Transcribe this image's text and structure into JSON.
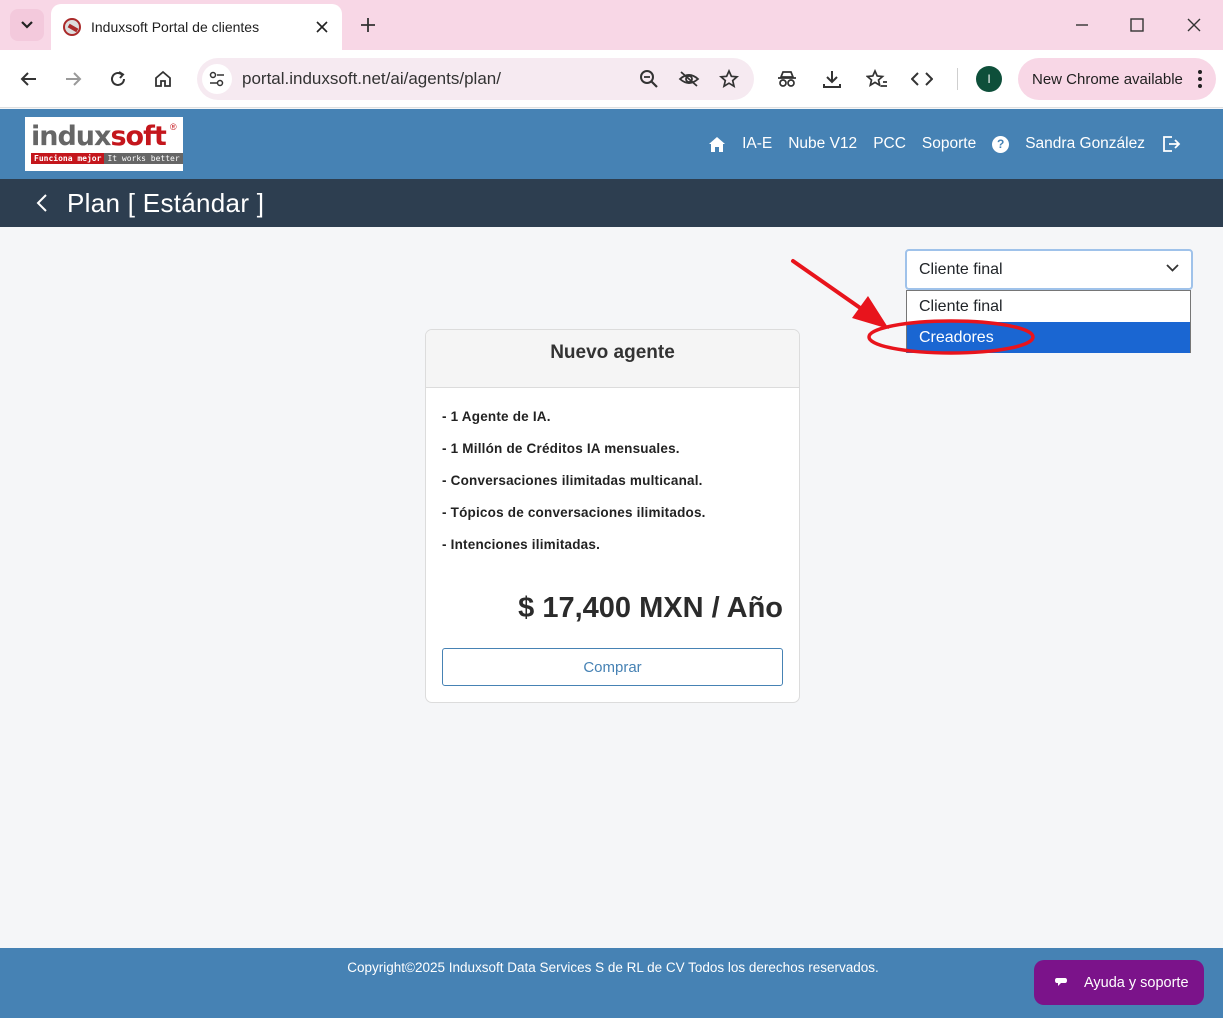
{
  "browser": {
    "tab_title": "Induxsoft Portal de clientes",
    "url": "portal.induxsoft.net/ai/agents/plan/",
    "profile_initial": "I",
    "update_label": "New Chrome available"
  },
  "site": {
    "logo": {
      "word_part1": "indux",
      "word_part2": "soft",
      "reg_mark": "®",
      "tag_red": "Funciona mejor",
      "tag_gray": "It works better"
    },
    "nav": {
      "items": [
        "IA-E",
        "Nube V12",
        "PCC",
        "Soporte"
      ],
      "help": "?",
      "user": "Sandra González"
    }
  },
  "page": {
    "title": "Plan [ Estándar ]",
    "select": {
      "value": "Cliente final",
      "options": [
        "Cliente final",
        "Creadores"
      ],
      "highlighted": "Creadores"
    },
    "card": {
      "heading": "Nuevo agente",
      "features": [
        "- 1 Agente de IA.",
        "- 1 Millón de Créditos IA mensuales.",
        "- Conversaciones ilimitadas multicanal.",
        "- Tópicos de conversaciones ilimitados.",
        "- Intenciones ilimitadas."
      ],
      "price": "$ 17,400 MXN / Año",
      "buy_label": "Comprar"
    }
  },
  "footer": {
    "copyright": "Copyright©2025 Induxsoft Data Services S de RL de CV Todos los derechos reservados.",
    "help_label": "Ayuda y soporte"
  },
  "colors": {
    "header": "#4682b4",
    "titlebar": "#2d3e50",
    "selected_option": "#1a66d2",
    "help_button": "#7b138a",
    "annotation": "#e8141c"
  }
}
